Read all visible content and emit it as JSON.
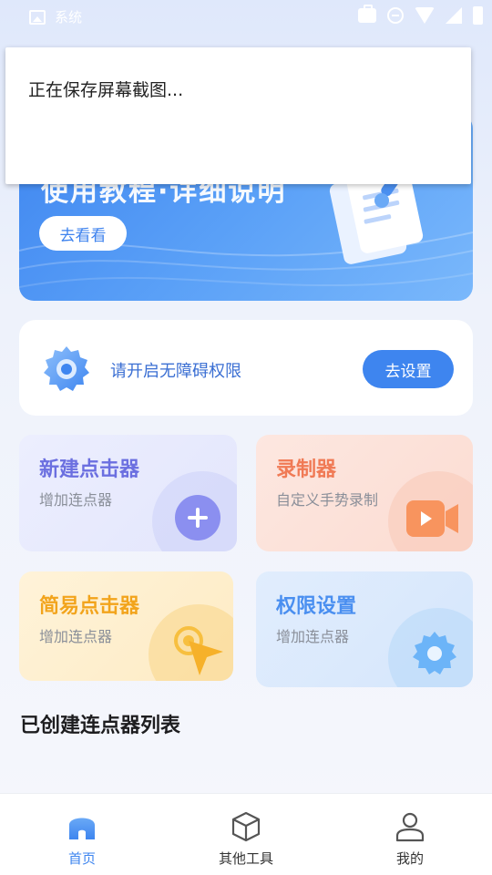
{
  "status_bar": {
    "label": "系统"
  },
  "banner": {
    "title": "使用教程·详细说明",
    "button_label": "去看看"
  },
  "toast": {
    "message": "正在保存屏幕截图..."
  },
  "permission": {
    "text": "请开启无障碍权限",
    "button_label": "去设置"
  },
  "features": [
    {
      "title": "新建点击器",
      "subtitle": "增加连点器"
    },
    {
      "title": "录制器",
      "subtitle": "自定义手势录制"
    },
    {
      "title": "简易点击器",
      "subtitle": "增加连点器"
    },
    {
      "title": "权限设置",
      "subtitle": "增加连点器"
    }
  ],
  "list_section": {
    "title": "已创建连点器列表"
  },
  "bottom_nav": {
    "items": [
      {
        "label": "首页",
        "icon": "home-icon",
        "active": true
      },
      {
        "label": "其他工具",
        "icon": "cube-icon",
        "active": false
      },
      {
        "label": "我的",
        "icon": "person-icon",
        "active": false
      }
    ]
  },
  "colors": {
    "accent": "#3e85ef",
    "tile_purple": "#6b6fe0",
    "tile_orange": "#f07a55",
    "tile_yellow": "#f2a41c",
    "tile_blue": "#4a8ff0"
  }
}
